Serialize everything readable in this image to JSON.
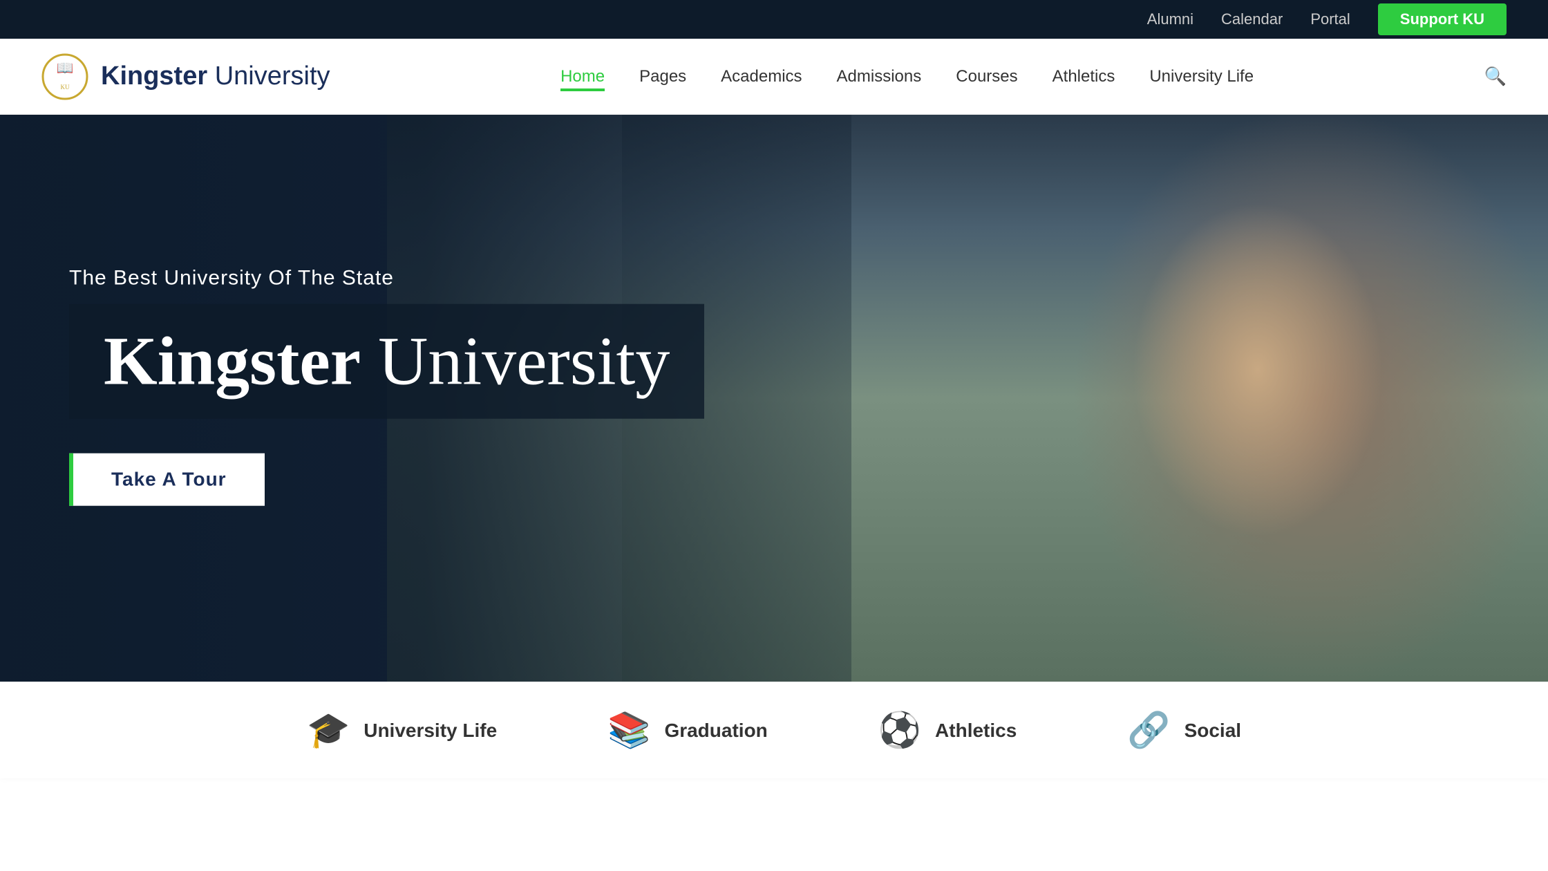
{
  "topbar": {
    "alumni_label": "Alumni",
    "calendar_label": "Calendar",
    "portal_label": "Portal",
    "support_label": "Support KU"
  },
  "navbar": {
    "logo_bold": "Kingster",
    "logo_light": " University",
    "nav_items": [
      {
        "id": "home",
        "label": "Home",
        "active": true
      },
      {
        "id": "pages",
        "label": "Pages",
        "active": false
      },
      {
        "id": "academics",
        "label": "Academics",
        "active": false
      },
      {
        "id": "admissions",
        "label": "Admissions",
        "active": false
      },
      {
        "id": "courses",
        "label": "Courses",
        "active": false
      },
      {
        "id": "athletics",
        "label": "Athletics",
        "active": false
      },
      {
        "id": "university-life",
        "label": "University Life",
        "active": false
      }
    ]
  },
  "hero": {
    "subtitle": "The Best University Of The State",
    "title_bold": "Kingster",
    "title_light": " University",
    "cta_label": "Take A Tour"
  },
  "bottom_strip": {
    "items": [
      {
        "id": "university-life",
        "icon": "🎓",
        "label": "University Life"
      },
      {
        "id": "graduation",
        "icon": "📚",
        "label": "Graduation"
      },
      {
        "id": "athletics",
        "icon": "⚽",
        "label": "Athletics"
      },
      {
        "id": "social",
        "icon": "🔗",
        "label": "Social"
      }
    ]
  },
  "colors": {
    "green": "#2ecc40",
    "navy": "#1a2e5a",
    "dark": "#0d1b2a"
  }
}
